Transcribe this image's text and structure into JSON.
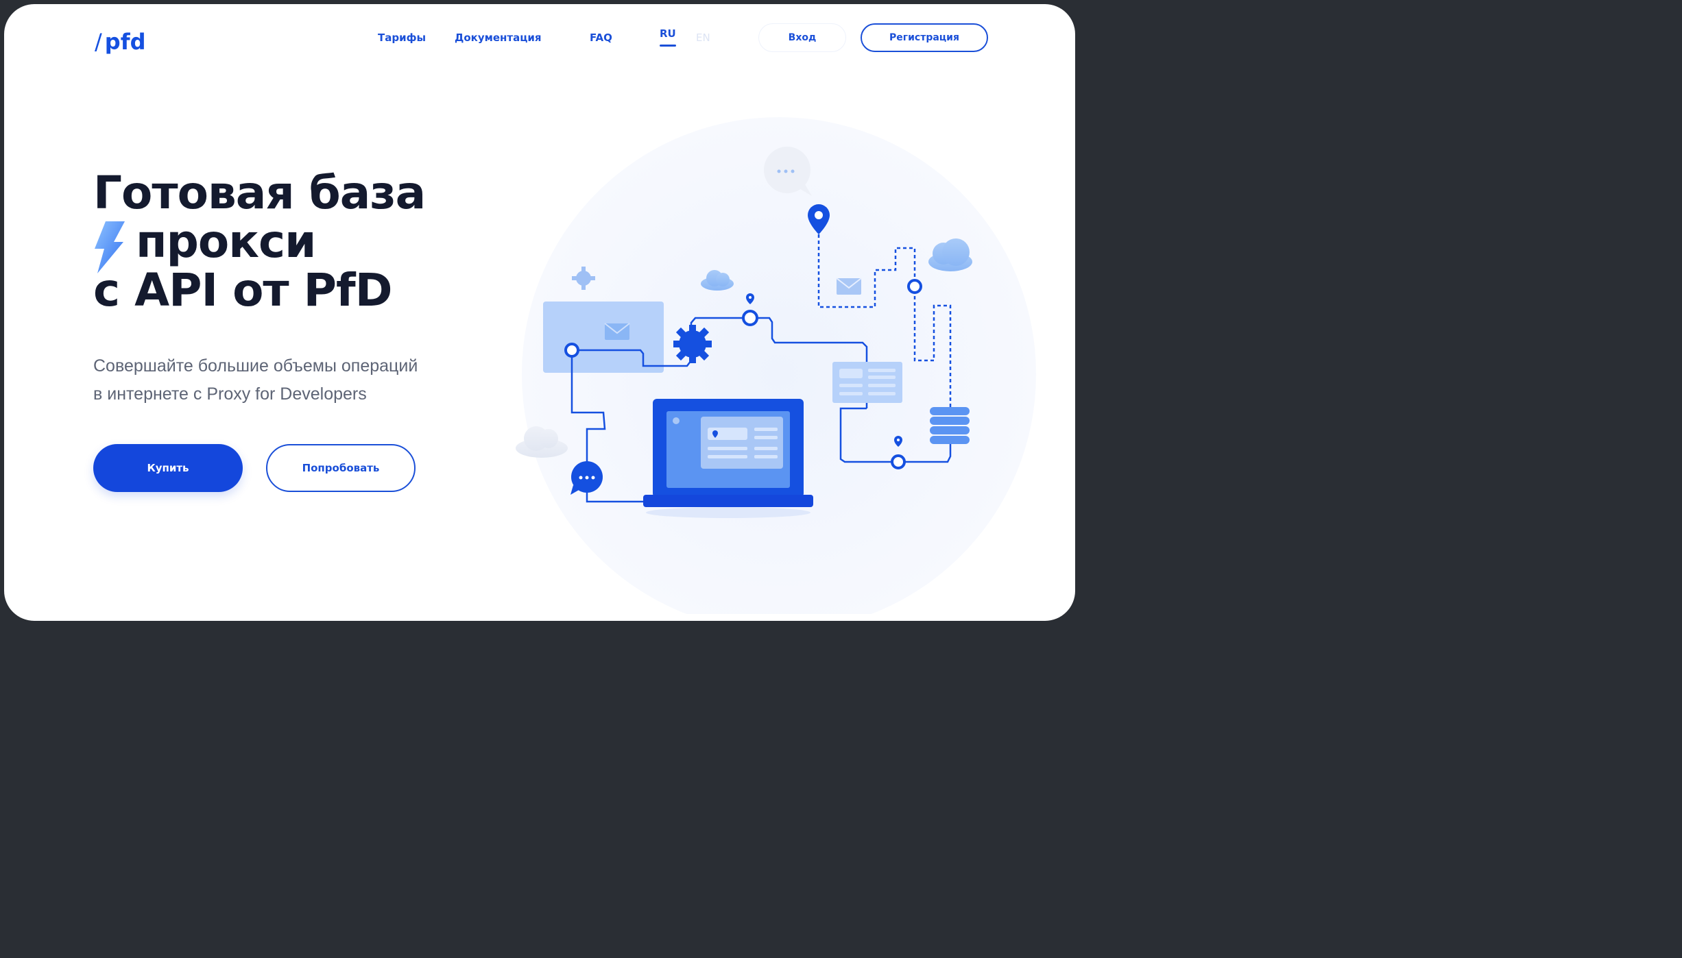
{
  "header": {
    "logo_slash": "/",
    "logo_text": "pfd",
    "nav": [
      "Тарифы",
      "Документация",
      "FAQ"
    ],
    "lang_active": "RU",
    "lang_inactive": "EN",
    "login_label": "Вход",
    "register_label": "Регистрация"
  },
  "hero": {
    "title_line1": "Готовая база",
    "title_line2": "прокси",
    "title_line3": "с API от PfD",
    "subtitle_line1": "Совершайте большие объемы операций",
    "subtitle_line2": "в интернете с Proxy for Developers",
    "buy_label": "Купить",
    "try_label": "Попробовать"
  },
  "colors": {
    "brand": "#1a4fd8",
    "brand_dark": "#1447dc",
    "title": "#141a2e",
    "subtitle": "#5d6475",
    "light_blue": "#a9c7f6",
    "pale": "#f3f6fd"
  },
  "icons": [
    "lightning-icon",
    "gear-icon",
    "envelope-icon",
    "cloud-icon",
    "location-pin-icon",
    "chat-bubble-icon",
    "laptop-icon",
    "database-icon"
  ]
}
